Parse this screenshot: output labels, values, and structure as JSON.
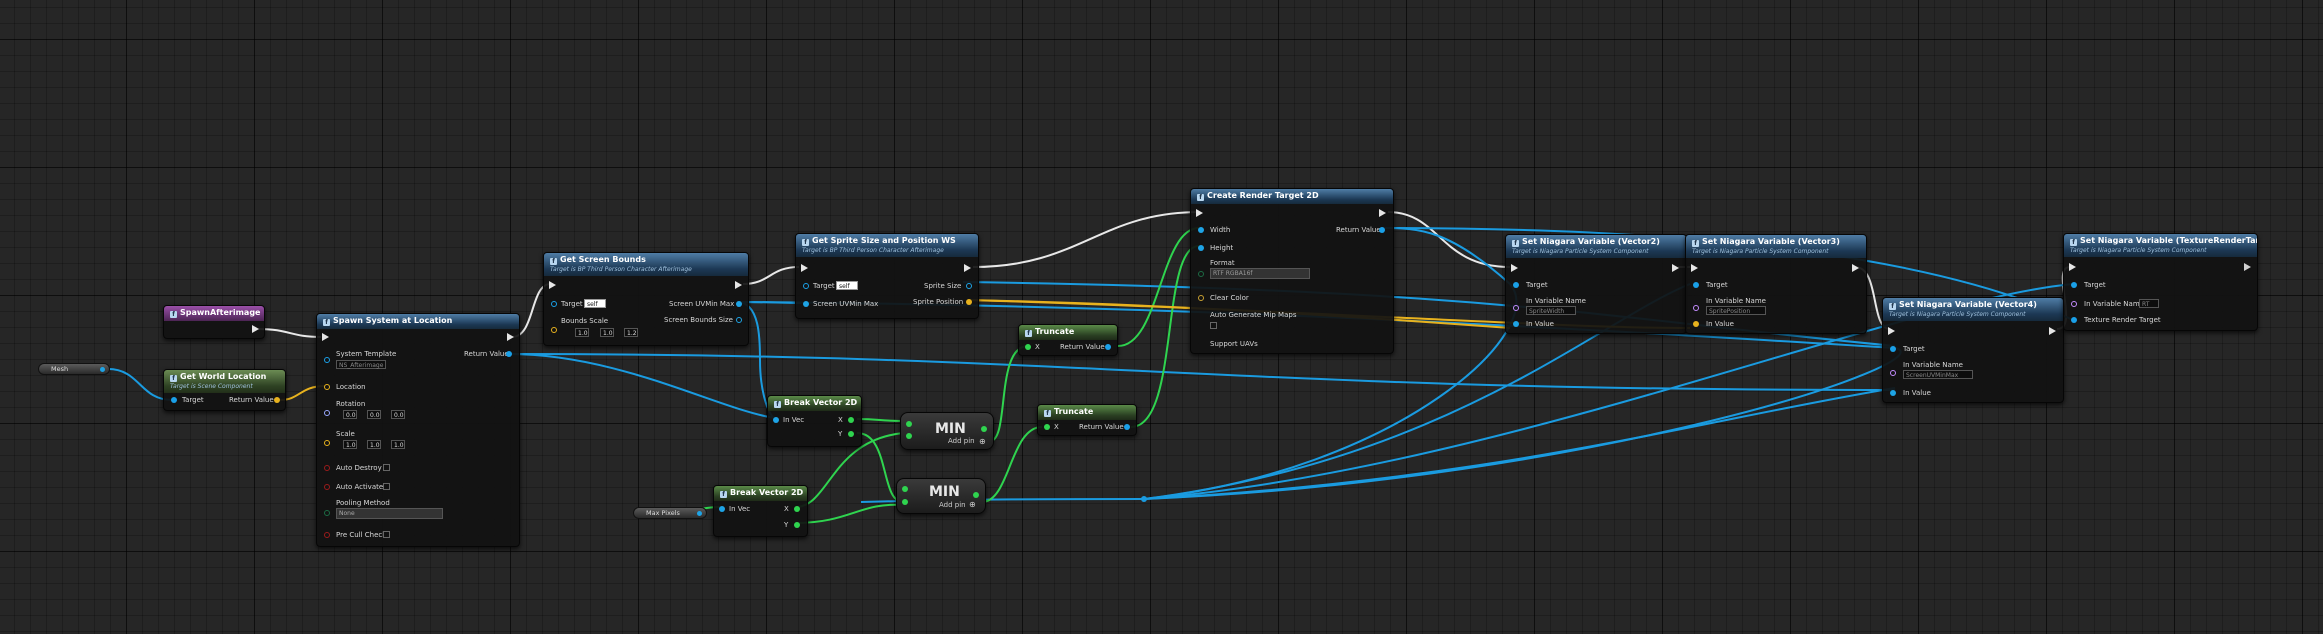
{
  "colors": {
    "exec": "#e6e6e6",
    "vector": "#1ea4e6",
    "vector2d": "#1ea4e6",
    "float": "#2fd44f",
    "object": "#1aa0e8",
    "rotator": "#9aa8ff",
    "struct": "#e8b21e",
    "bool": "#9b1b1b",
    "name": "#c48cff"
  },
  "nodes": {
    "spawn_afterimage": {
      "title": "SpawnAfterimage"
    },
    "get_world_location": {
      "title": "Get World Location",
      "subtitle": "Target is Scene Component",
      "target": "Target",
      "return": "Return Value"
    },
    "mesh_var": {
      "label": "Mesh"
    },
    "spawn_system": {
      "title": "Spawn System at Location",
      "system_template": "System Template",
      "template_value": "NS_Afterimage",
      "return": "Return Value",
      "location": "Location",
      "rotation": "Rotation",
      "rot_values": [
        "0.0",
        "0.0",
        "0.0"
      ],
      "scale": "Scale",
      "scale_values": [
        "1.0",
        "1.0",
        "1.0"
      ],
      "auto_destroy": "Auto Destroy",
      "auto_activate": "Auto Activate",
      "pooling_method": "Pooling Method",
      "pooling_value": "None",
      "pre_cull_check": "Pre Cull Check"
    },
    "get_screen_bounds": {
      "title": "Get Screen Bounds",
      "subtitle": "Target is BP Third Person Character Afterimage",
      "target": "Target",
      "target_value": "self",
      "bounds_scale": "Bounds Scale",
      "bs_values": [
        "1.0",
        "1.0",
        "1.2"
      ],
      "out1": "Screen UVMin Max",
      "out2": "Screen Bounds Size"
    },
    "get_sprite_size": {
      "title": "Get Sprite Size and Position WS",
      "subtitle": "Target is BP Third Person Character Afterimage",
      "target": "Target",
      "target_value": "self",
      "in2": "Screen UVMin Max",
      "out1": "Sprite Size",
      "out2": "Sprite Position"
    },
    "break_vector_1": {
      "title": "Break Vector 2D",
      "in": "In Vec",
      "x": "X",
      "y": "Y"
    },
    "break_vector_2": {
      "title": "Break Vector 2D",
      "in": "In Vec",
      "x": "X",
      "y": "Y"
    },
    "max_pixels_var": {
      "label": "Max Pixels"
    },
    "min_1": {
      "title": "MIN",
      "addpin": "Add pin"
    },
    "min_2": {
      "title": "MIN",
      "addpin": "Add pin"
    },
    "truncate_1": {
      "title": "Truncate",
      "x": "X",
      "return": "Return Value"
    },
    "truncate_2": {
      "title": "Truncate",
      "x": "X",
      "return": "Return Value"
    },
    "create_rt": {
      "title": "Create Render Target 2D",
      "width": "Width",
      "height": "Height",
      "format": "Format",
      "format_value": "RTF RGBA16f",
      "clear_color": "Clear Color",
      "auto_mips": "Auto Generate Mip Maps",
      "support_uavs": "Support UAVs",
      "return": "Return Value"
    },
    "set_niagara_v2": {
      "title": "Set Niagara Variable (Vector2)",
      "subtitle": "Target is Niagara Particle System Component",
      "target": "Target",
      "var_name_label": "In Variable Name",
      "var_name": "SpriteWidth",
      "in_value": "In Value"
    },
    "set_niagara_v3": {
      "title": "Set Niagara Variable (Vector3)",
      "subtitle": "Target is Niagara Particle System Component",
      "target": "Target",
      "var_name_label": "In Variable Name",
      "var_name": "SpritePosition",
      "in_value": "In Value"
    },
    "set_niagara_v4": {
      "title": "Set Niagara Variable (Vector4)",
      "subtitle": "Target is Niagara Particle System Component",
      "target": "Target",
      "var_name_label": "In Variable Name",
      "var_name": "ScreenUVMinMax",
      "in_value": "In Value"
    },
    "set_niagara_rt": {
      "title": "Set Niagara Variable (TextureRenderTarget)",
      "subtitle": "Target is Niagara Particle System Component",
      "target": "Target",
      "var_name_label": "In Variable Name",
      "var_name": "RT",
      "texture_target": "Texture Render Target"
    }
  }
}
